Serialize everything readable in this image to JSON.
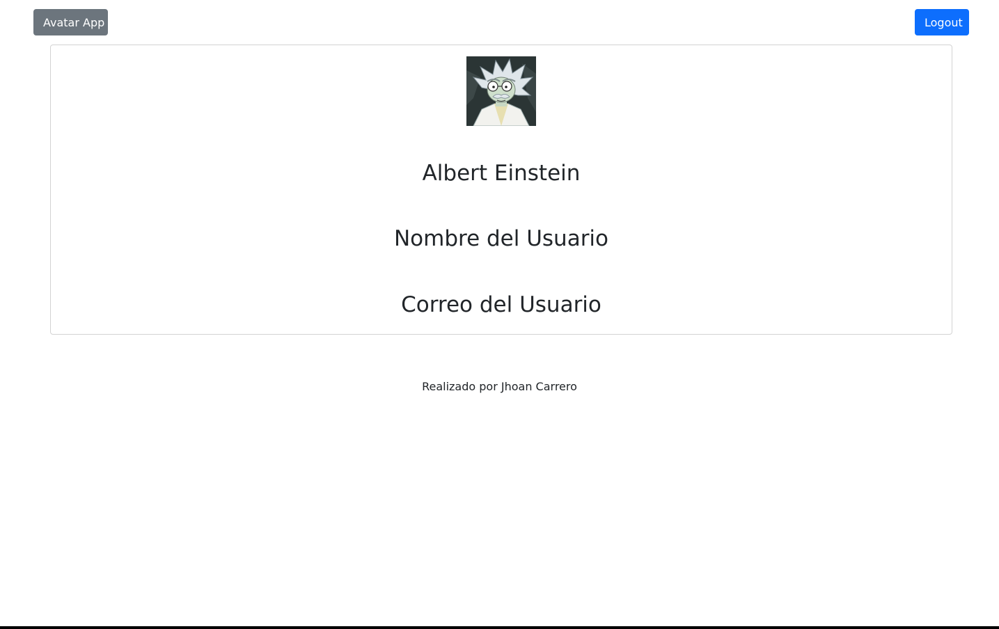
{
  "navbar": {
    "brand_label": "Avatar App",
    "logout_label": "Logout"
  },
  "profile": {
    "avatar_icon": "cartoon-scientist-avatar",
    "name": "Albert Einstein",
    "username_label": "Nombre del Usuario",
    "email_label": "Correo del Usuario"
  },
  "footer": {
    "credit": "Realizado por Jhoan Carrero"
  },
  "colors": {
    "brand_button": "#6c757d",
    "logout_button": "#0d6efd",
    "text": "#212529"
  }
}
